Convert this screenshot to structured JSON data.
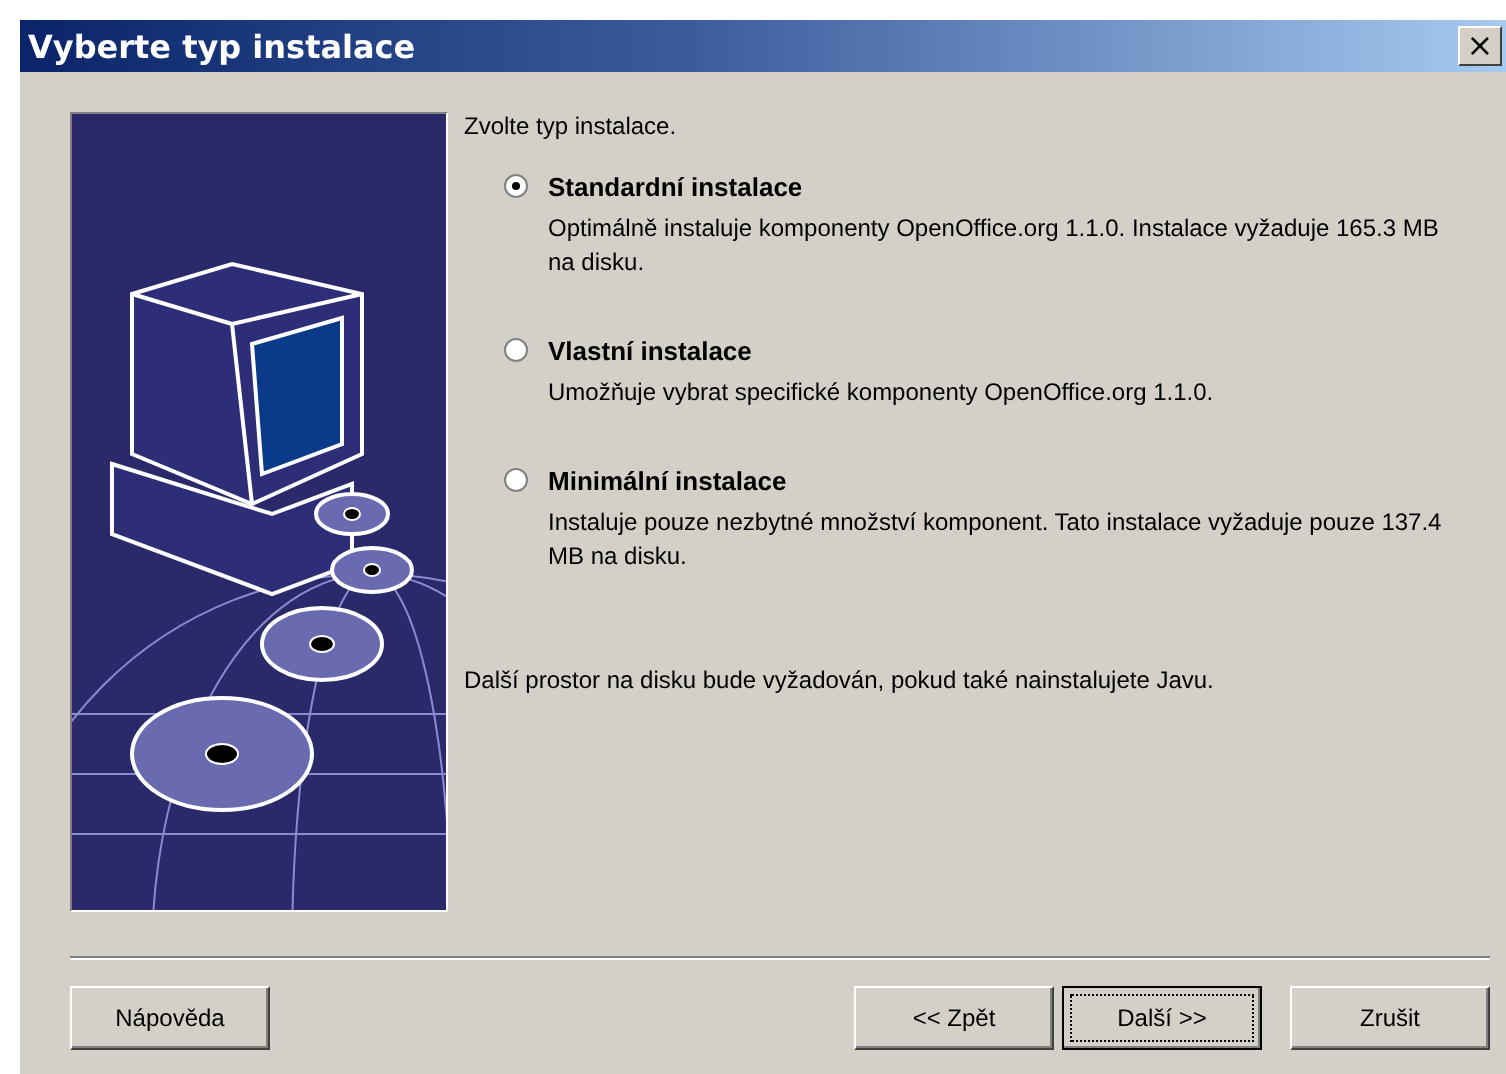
{
  "window": {
    "title": "Vyberte typ instalace",
    "close": "×"
  },
  "prompt": "Zvolte typ instalace.",
  "options": [
    {
      "label": "Standardní instalace",
      "description": "Optimálně instaluje komponenty OpenOffice.org 1.1.0. Instalace vyžaduje 165.3 MB na disku.",
      "selected": true
    },
    {
      "label": "Vlastní instalace",
      "description": "Umožňuje vybrat specifické komponenty OpenOffice.org 1.1.0.",
      "selected": false
    },
    {
      "label": "Minimální instalace",
      "description": "Instaluje pouze nezbytné množství komponent. Tato instalace vyžaduje pouze 137.4 MB na disku.",
      "selected": false
    }
  ],
  "note": "Další prostor na disku bude vyžadován, pokud také nainstalujete Javu.",
  "buttons_left": [
    {
      "label": "Nápověda",
      "focused": false
    }
  ],
  "buttons_right": [
    {
      "label": "<< Zpět",
      "focused": false
    },
    {
      "label": "Další >>",
      "focused": true
    },
    {
      "label": "Zrušit",
      "focused": false
    }
  ]
}
